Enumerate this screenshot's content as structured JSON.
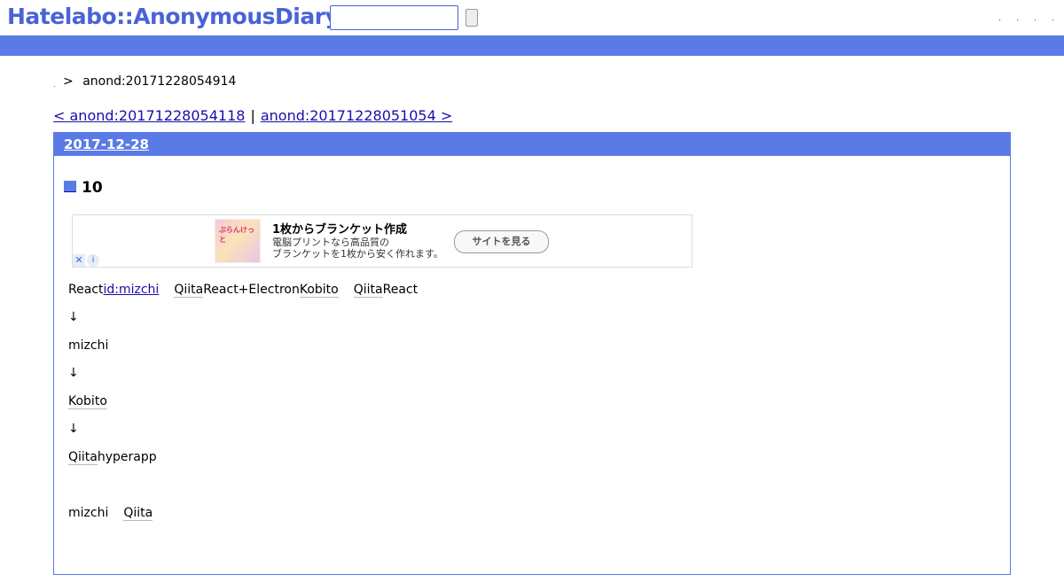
{
  "header": {
    "logo": "Hatelabo::AnonymousDiary",
    "search": {
      "value": "",
      "placeholder": ""
    },
    "search_button_label": "",
    "nav_dots": [
      ".",
      ".",
      ".",
      "."
    ]
  },
  "breadcrumb": {
    "home": ".",
    "separator": ">",
    "current": "anond:20171228054914"
  },
  "pager": {
    "prev": "< anond:20171228054118",
    "separator": "|",
    "next": "anond:20171228051054 >"
  },
  "day": {
    "date": "2017-12-28",
    "section_title": "10",
    "ad": {
      "thumb_text": "ぶらんけっと",
      "title": "1枚からブランケット作成",
      "desc_line1": "電脳プリントなら高品質の",
      "desc_line2": "ブランケットを1枚から安く作れます。",
      "cta": "サイトを見る",
      "close": "✕",
      "info": "i"
    },
    "lines": [
      {
        "parts": [
          "React",
          "id:mizchi",
          "Qiita",
          "React+Electron",
          "Kobito",
          "Qiita",
          "React"
        ]
      },
      {
        "text": "↓"
      },
      {
        "text": "mizchi"
      },
      {
        "text": "↓"
      },
      {
        "text": "Kobito"
      },
      {
        "text": "↓"
      },
      {
        "parts": [
          "Qiita",
          "hyperapp"
        ]
      },
      {
        "parts": [
          "mizchi",
          "Qiita"
        ]
      }
    ]
  },
  "colors": {
    "accent": "#5a7be6",
    "logo": "#4a63d6",
    "link": "#1a0dab"
  }
}
